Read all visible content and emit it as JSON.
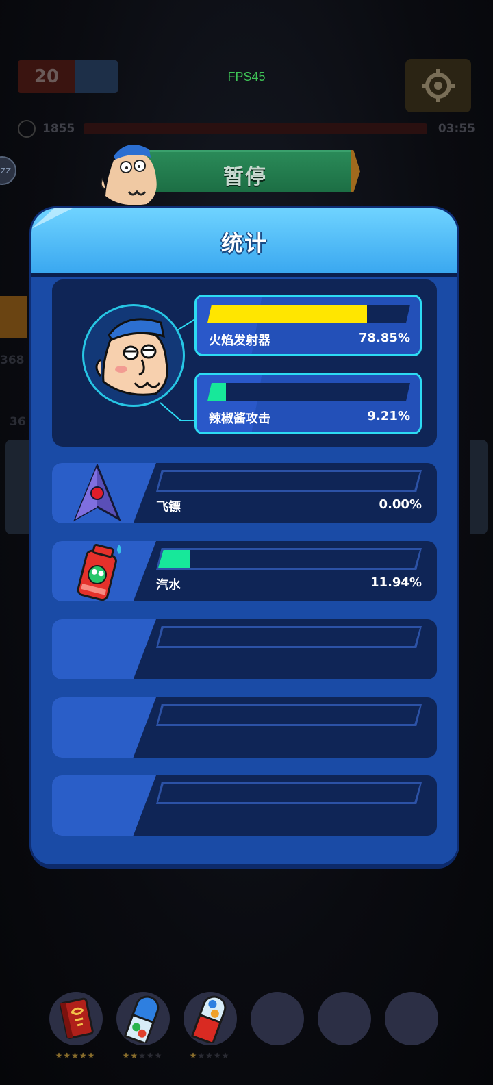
{
  "hud": {
    "level": "20",
    "fps": "FPS45",
    "kills": "1855",
    "timer": "03:55",
    "zz_badge": "ZZ",
    "side_number_1": "368",
    "side_number_2": "36"
  },
  "pause_banner": {
    "label": "暂停"
  },
  "stats_panel": {
    "title": "统计",
    "character_stats": [
      {
        "name": "火焰发射器",
        "percent_text": "78.85%",
        "fraction": 0.7885,
        "fill_color": "#ffe600"
      },
      {
        "name": "辣椒酱攻击",
        "percent_text": "9.21%",
        "fraction": 0.0921,
        "fill_color": "#17e89a"
      }
    ],
    "weapons": [
      {
        "name": "飞镖",
        "percent_text": "0.00%",
        "fraction": 0.0,
        "icon": "dart-icon",
        "fill_color": "#17e89a"
      },
      {
        "name": "汽水",
        "percent_text": "11.94%",
        "fraction": 0.1194,
        "icon": "soda-can-icon",
        "fill_color": "#17e89a"
      },
      {
        "name": "",
        "percent_text": "",
        "fraction": 0.0,
        "icon": "",
        "fill_color": "#17e89a"
      },
      {
        "name": "",
        "percent_text": "",
        "fraction": 0.0,
        "icon": "",
        "fill_color": "#17e89a"
      },
      {
        "name": "",
        "percent_text": "",
        "fraction": 0.0,
        "icon": "",
        "fill_color": "#17e89a"
      }
    ]
  },
  "item_slots": [
    {
      "icon": "red-book-icon",
      "stars": 5,
      "max_stars": 5
    },
    {
      "icon": "blue-capsule-icon",
      "stars": 2,
      "max_stars": 5
    },
    {
      "icon": "red-capsule-icon",
      "stars": 1,
      "max_stars": 5
    },
    {
      "icon": "",
      "stars": 0,
      "max_stars": 0
    },
    {
      "icon": "",
      "stars": 0,
      "max_stars": 0
    },
    {
      "icon": "",
      "stars": 0,
      "max_stars": 0
    }
  ],
  "colors": {
    "panel_blue": "#1a4ba6",
    "header_cyan": "#3aa8f0",
    "highlight_border": "#2ddbf3",
    "pause_green": "#1c6e44"
  }
}
